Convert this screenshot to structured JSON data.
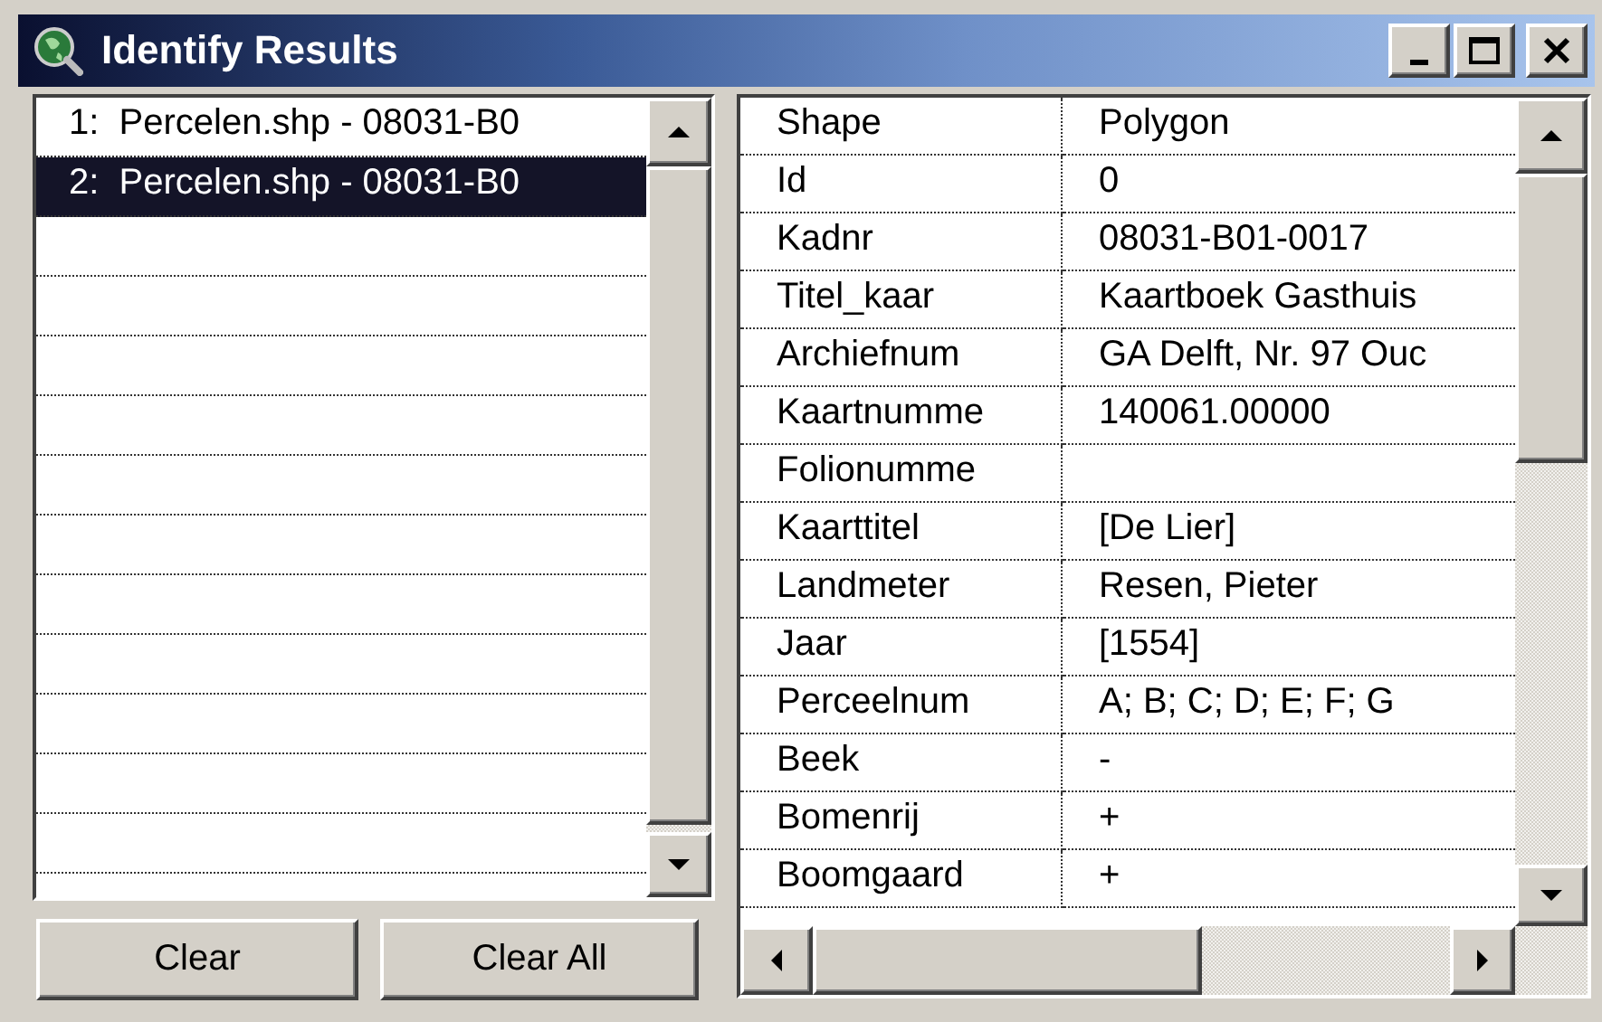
{
  "window": {
    "title": "Identify Results"
  },
  "results": [
    {
      "label": "1:  Percelen.shp - 08031-B0",
      "selected": false
    },
    {
      "label": "2:  Percelen.shp - 08031-B0",
      "selected": true
    }
  ],
  "buttons": [
    "Clear",
    "Clear All"
  ],
  "attributes": [
    {
      "field": "Shape",
      "value": "Polygon"
    },
    {
      "field": "Id",
      "value": "0"
    },
    {
      "field": "Kadnr",
      "value": "08031-B01-0017"
    },
    {
      "field": "Titel_kaar",
      "value": "Kaartboek Gasthuis"
    },
    {
      "field": "Archiefnum",
      "value": "GA Delft, Nr. 97 Ouc"
    },
    {
      "field": "Kaartnumme",
      "value": "140061.00000"
    },
    {
      "field": "Folionumme"
    },
    {
      "field": "Kaarttitel",
      "value": "[De Lier]"
    },
    {
      "field": "Landmeter",
      "value": "Resen, Pieter"
    },
    {
      "field": "Jaar",
      "value": "[1554]"
    },
    {
      "field": "Perceelnum",
      "value": "A; B; C; D; E; F; G"
    },
    {
      "field": "Beek",
      "value": "-"
    },
    {
      "field": "Bomenrij",
      "value": "+"
    },
    {
      "field": "Boomgaard",
      "value": "+"
    }
  ]
}
